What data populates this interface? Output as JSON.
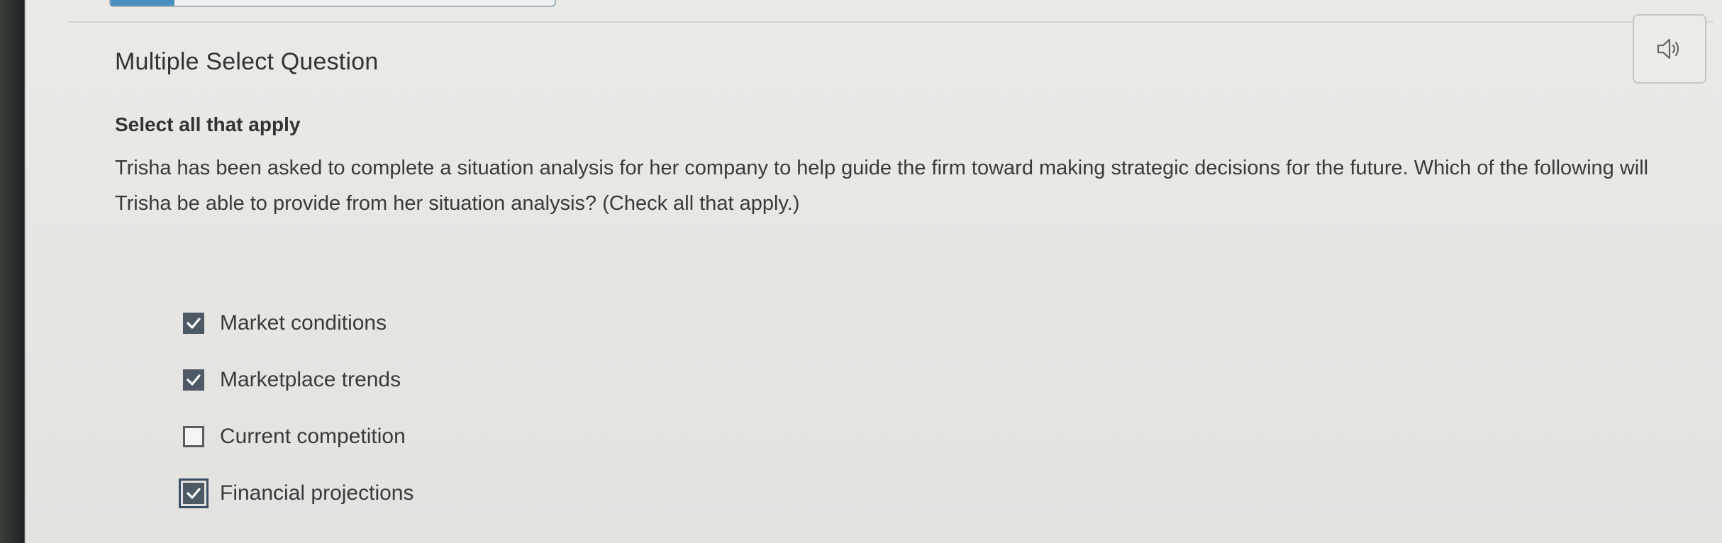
{
  "header": {
    "question_type": "Multiple Select Question",
    "audio_icon": "speaker-icon"
  },
  "question": {
    "instruction": "Select all that apply",
    "prompt": "Trisha has been asked to complete a situation analysis for her company to help guide the firm toward making strategic decisions for the future. Which of the following will Trisha be able to provide from her situation analysis? (Check all that apply.)"
  },
  "options": [
    {
      "label": "Market conditions",
      "checked": true
    },
    {
      "label": "Marketplace trends",
      "checked": true
    },
    {
      "label": "Current competition",
      "checked": false
    },
    {
      "label": "Financial projections",
      "checked": true,
      "focused": true
    }
  ],
  "colors": {
    "checkbox_checked": "#4d5a66",
    "accent": "#4a8fc0"
  }
}
